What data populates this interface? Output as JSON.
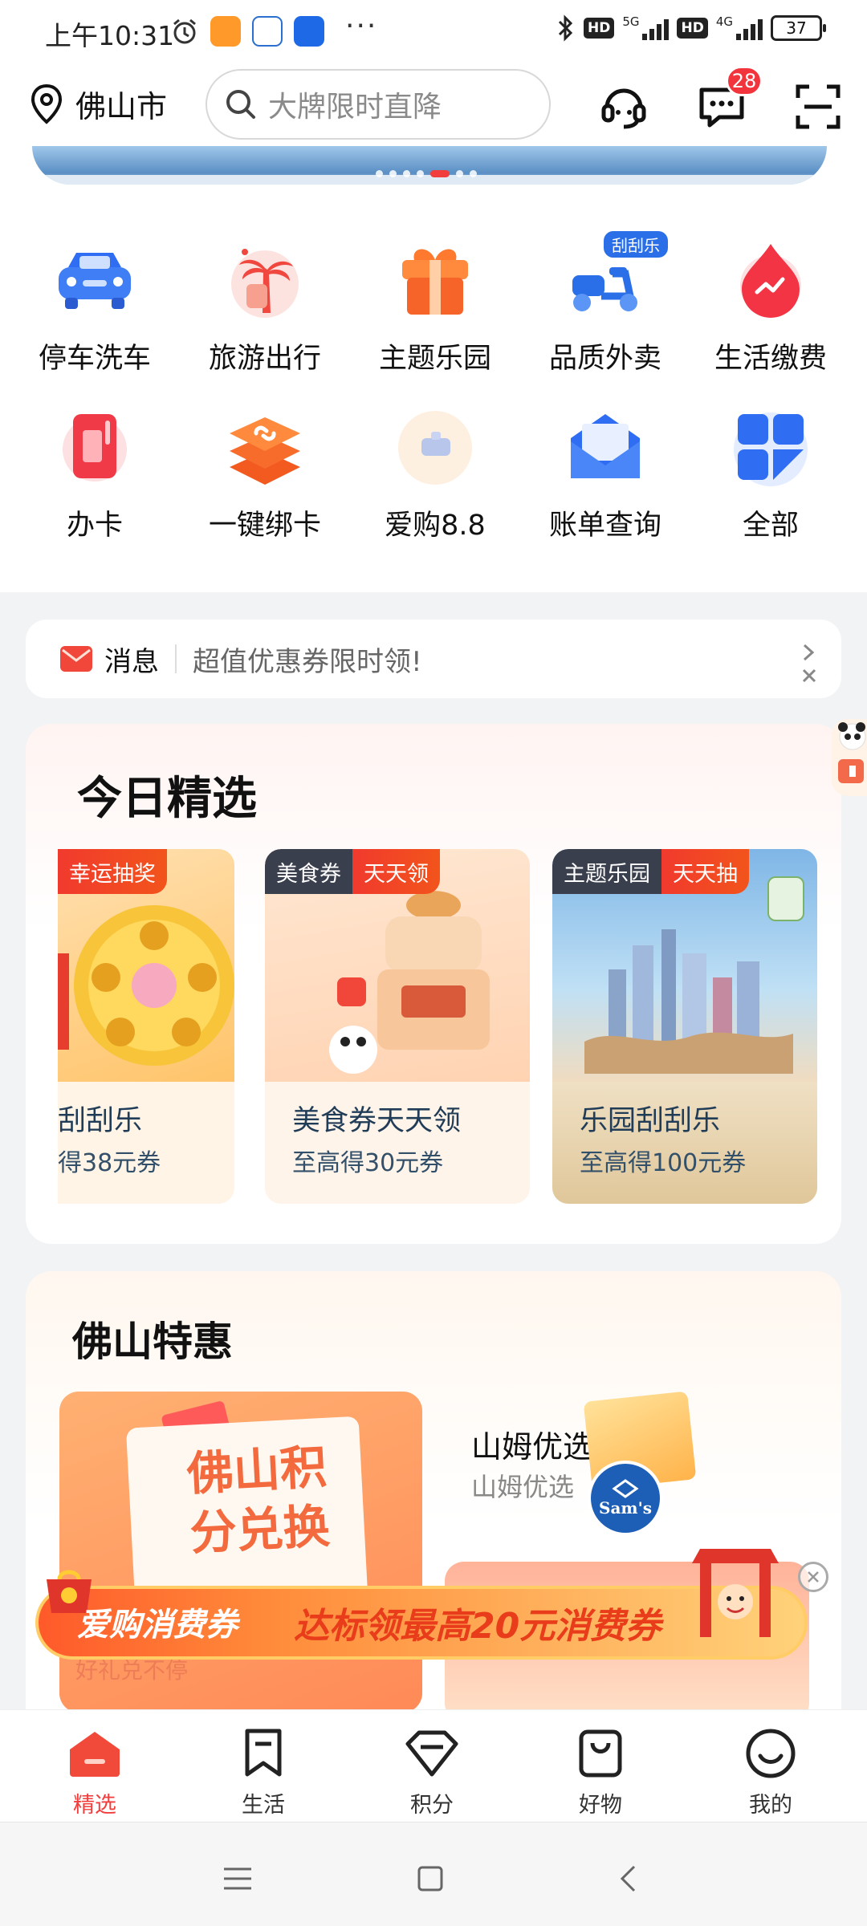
{
  "status_bar": {
    "time": "上午10:31",
    "net_5g": "5G",
    "net_4g": "4G",
    "hd": "HD",
    "battery": "37",
    "more": "···"
  },
  "header": {
    "city": "佛山市",
    "search_placeholder": "大牌限时直降",
    "message_count": "28"
  },
  "quick_grid": [
    {
      "label": "停车洗车",
      "icon": "car-icon"
    },
    {
      "label": "旅游出行",
      "icon": "palm-tree-icon"
    },
    {
      "label": "主题乐园",
      "icon": "gift-box-icon"
    },
    {
      "label": "品质外卖",
      "icon": "scooter-icon",
      "badge": "刮刮乐"
    },
    {
      "label": "生活缴费",
      "icon": "flame-icon"
    },
    {
      "label": "办卡",
      "icon": "card-icon"
    },
    {
      "label": "一键绑卡",
      "icon": "link-stack-icon"
    },
    {
      "label": "爱购8.8",
      "icon": "aigou-icon"
    },
    {
      "label": "账单查询",
      "icon": "envelope-icon"
    },
    {
      "label": "全部",
      "icon": "grid-icon"
    }
  ],
  "message_bar": {
    "title": "消息",
    "text": "超值优惠券限时领!"
  },
  "today_picks": {
    "title": "今日精选",
    "cards": [
      {
        "tag_dark": "",
        "tag_red": "幸运抽奖",
        "title": "刮刮乐",
        "subtitle": "得38元券"
      },
      {
        "tag_dark": "美食券",
        "tag_red": "天天领",
        "title": "美食券天天领",
        "subtitle": "至高得30元券"
      },
      {
        "tag_dark": "主题乐园",
        "tag_red": "天天抽",
        "title": "乐园刮刮乐",
        "subtitle": "至高得100元券"
      }
    ]
  },
  "foshan_deals": {
    "title": "佛山特惠",
    "big_card_text": "佛山积分兑换",
    "big_card_sub": "好礼兑不停",
    "sams_title": "山姆优选",
    "sams_sub": "山姆优选",
    "sams_logo": "Sam's"
  },
  "coupon_banner": {
    "left": "爱购消费券",
    "right": "达标领最高20元消费券"
  },
  "bottom_nav": [
    {
      "label": "精选",
      "active": true
    },
    {
      "label": "生活",
      "active": false
    },
    {
      "label": "积分",
      "active": false
    },
    {
      "label": "好物",
      "active": false
    },
    {
      "label": "我的",
      "active": false
    }
  ],
  "colors": {
    "accent_red": "#f23d3d",
    "badge_red": "#f2353c",
    "card_text": "#213c57"
  }
}
